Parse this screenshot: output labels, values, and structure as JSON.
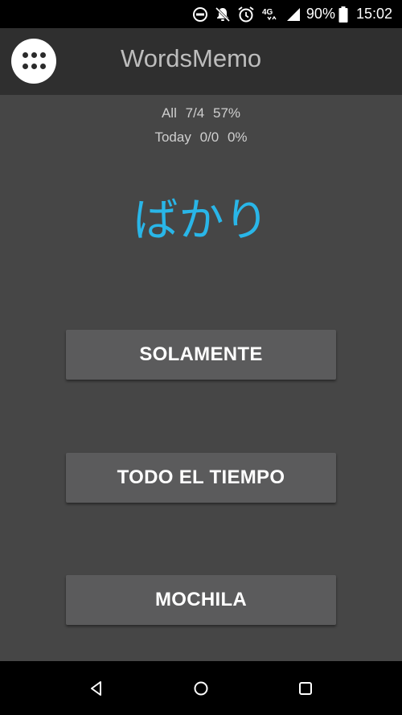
{
  "status_bar": {
    "battery_percent": "90%",
    "time": "15:02",
    "network_label": "4G",
    "icons": [
      "do-not-disturb-icon",
      "notifications-off-icon",
      "alarm-icon",
      "network-4g-icon",
      "signal-icon",
      "battery-icon"
    ]
  },
  "app_bar": {
    "title": "WordsMemo",
    "menu_icon": "apps-grid-icon"
  },
  "stats": {
    "all_label": "All",
    "all_count": "7/4",
    "all_percent": "57%",
    "today_label": "Today",
    "today_count": "0/0",
    "today_percent": "0%"
  },
  "word": "ばかり",
  "answers": [
    "SOLAMENTE",
    "TODO EL TIEMPO",
    "MOCHILA"
  ],
  "nav_bar": {
    "icons": [
      "back-icon",
      "home-icon",
      "recents-icon"
    ]
  },
  "colors": {
    "background": "#464646",
    "app_bar": "#2f2f2f",
    "word": "#29b6e8",
    "button": "#5b5b5c"
  }
}
